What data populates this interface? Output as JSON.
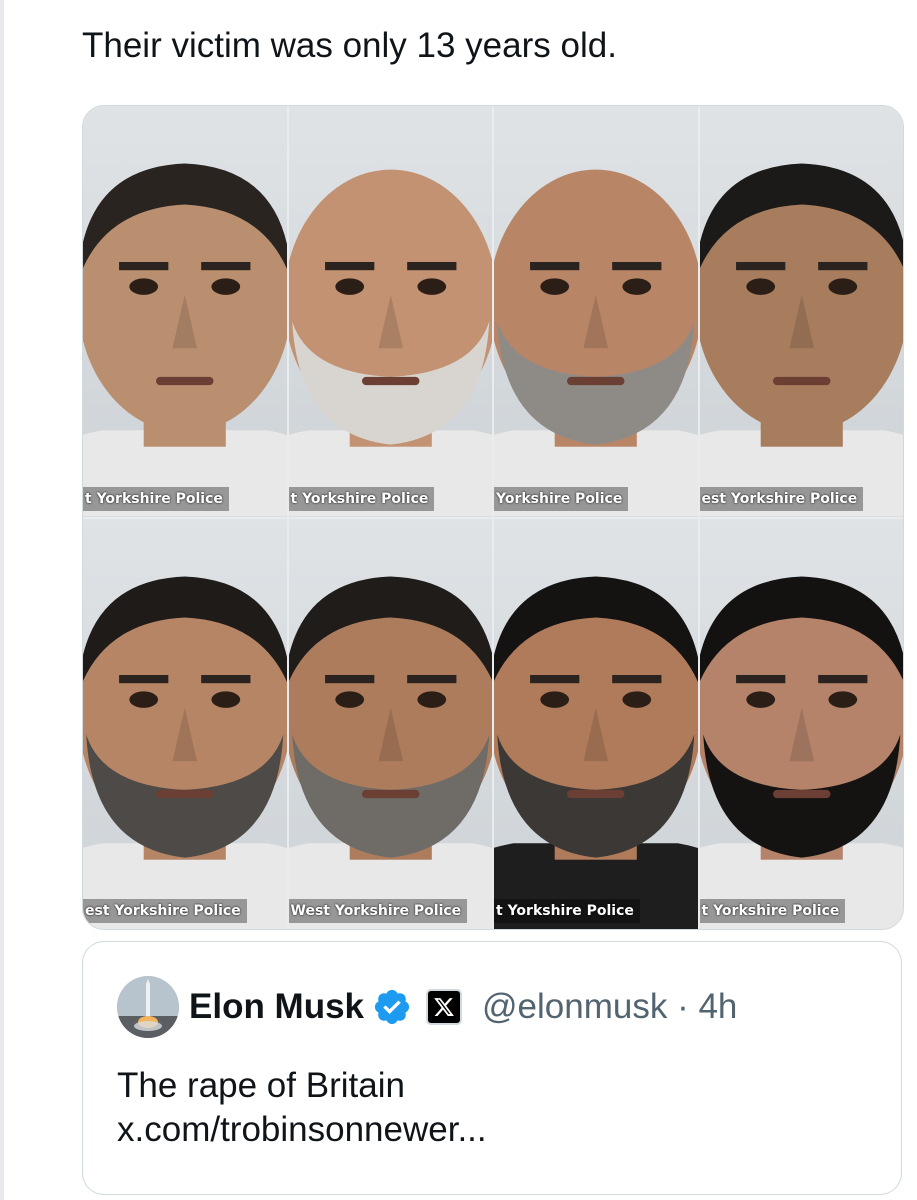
{
  "tweet": {
    "text": "Their victim was only 13 years old."
  },
  "media": {
    "photos": [
      {
        "credit": "t Yorkshire Police",
        "skin": "#b98f6f",
        "hair": "#2a2420",
        "beard": "none",
        "bald": false
      },
      {
        "credit": "t Yorkshire Police",
        "skin": "#c29273",
        "hair": "#c29273",
        "beard": "#d8d4cf",
        "bald": true
      },
      {
        "credit": " Yorkshire Police",
        "skin": "#b98567",
        "hair": "#b98567",
        "beard": "#8e8b87",
        "bald": true
      },
      {
        "credit": "est Yorkshire Police",
        "skin": "#a77d5e",
        "hair": "#1c1a18",
        "beard": "none",
        "bald": false
      },
      {
        "credit": "est Yorkshire Police",
        "skin": "#b68565",
        "hair": "#1e1b19",
        "beard": "#4d4a47",
        "bald": false
      },
      {
        "credit": "West Yorkshire Police",
        "skin": "#ad7c5d",
        "hair": "#1f1c1a",
        "beard": "#6f6b67",
        "bald": false
      },
      {
        "credit": "t Yorkshire Police",
        "skin": "#b07b5b",
        "hair": "#151312",
        "beard": "#3c3835",
        "bald": false
      },
      {
        "credit": "t Yorkshire Police",
        "skin": "#b4836a",
        "hair": "#141211",
        "beard": "#151312",
        "bald": false
      }
    ]
  },
  "quote": {
    "name": "Elon Musk",
    "verified_icon": "verified-badge-icon",
    "affiliate_icon": "x-logo-icon",
    "x_glyph": "𝕏",
    "handle_time": "@elonmusk · 4h",
    "line1": "The rape of Britain",
    "line2": "x.com/trobinsonnewer..."
  },
  "colors": {
    "verified": "#1d9bf0",
    "border": "#cfd9de",
    "secondary_text": "#536471"
  }
}
